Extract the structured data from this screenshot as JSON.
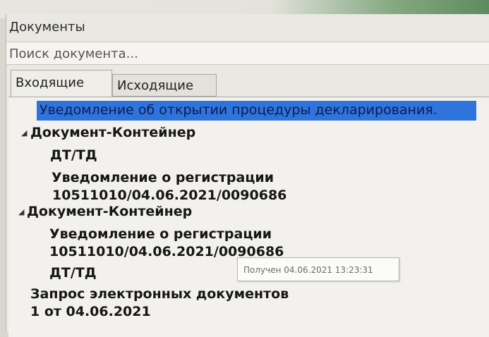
{
  "window": {
    "title": "Документы"
  },
  "search": {
    "placeholder": "Поиск документа..."
  },
  "tabs": [
    {
      "label": "Входящие"
    },
    {
      "label": "Исходящие"
    }
  ],
  "tree": {
    "selected": "Уведомление об открытии процедуры декларирования.",
    "groups": [
      {
        "label": "Документ-Контейнер",
        "children": [
          "ДТ/ТД",
          "Уведомление о регистрации",
          "10511010/04.06.2021/0090686"
        ]
      },
      {
        "label": "Документ-Контейнер",
        "children": [
          "Уведомление о регистрации",
          "10511010/04.06.2021/0090686",
          "ДТ/ТД"
        ]
      }
    ],
    "request_lines": [
      "Запрос электронных документов",
      "1 от 04.06.2021"
    ]
  },
  "tooltip": {
    "text": "Получен 04.06.2021 13:23:31"
  }
}
